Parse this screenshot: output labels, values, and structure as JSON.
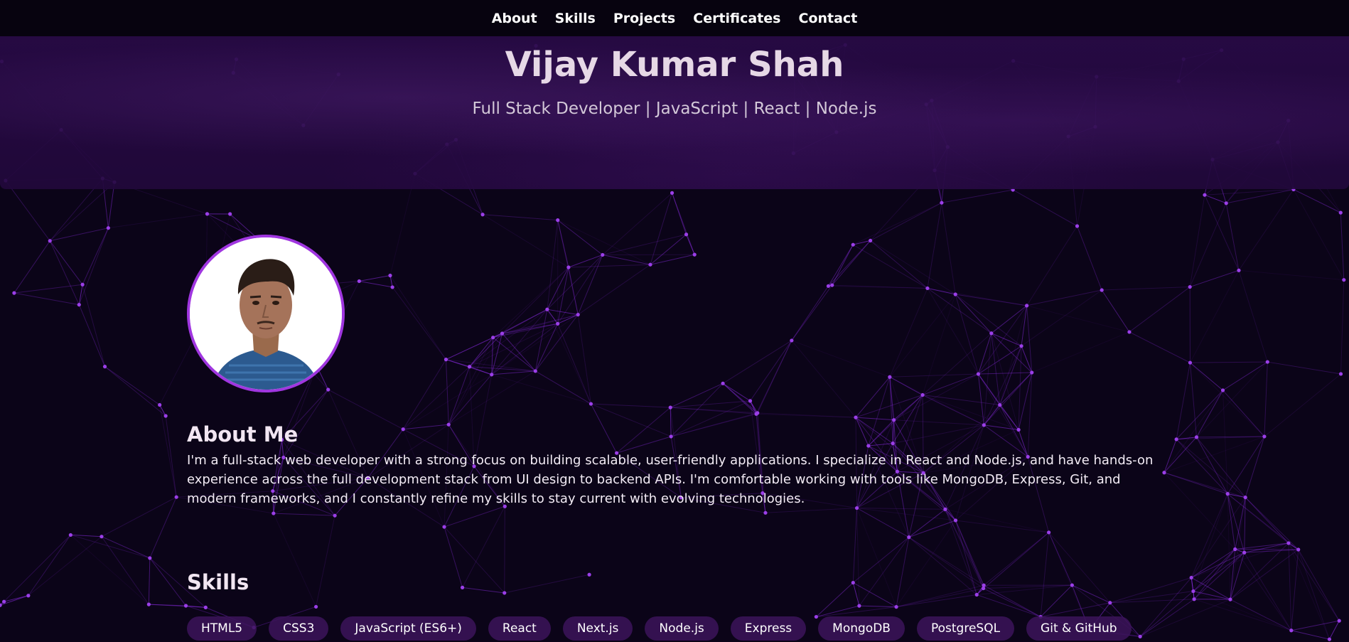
{
  "nav": {
    "items": [
      {
        "label": "About"
      },
      {
        "label": "Skills"
      },
      {
        "label": "Projects"
      },
      {
        "label": "Certificates"
      },
      {
        "label": "Contact"
      }
    ]
  },
  "hero": {
    "name": "Vijay Kumar Shah",
    "tagline": "Full Stack Developer | JavaScript | React | Node.js"
  },
  "about": {
    "title": "About Me",
    "text": "I'm a full-stack web developer with a strong focus on building scalable, user-friendly applications. I specialize in React and Node.js, and have hands-on experience across the full development stack from UI design to backend APIs. I'm comfortable working with tools like MongoDB, Express, Git, and modern frameworks, and I constantly refine my skills to stay current with evolving technologies."
  },
  "skills": {
    "title": "Skills",
    "items": [
      "HTML5",
      "CSS3",
      "JavaScript (ES6+)",
      "React",
      "Next.js",
      "Node.js",
      "Express",
      "MongoDB",
      "PostgreSQL",
      "Git & GitHub"
    ]
  },
  "colors": {
    "accent": "#a036e0",
    "background": "#0b0418",
    "network_line": "#8a2be2"
  }
}
